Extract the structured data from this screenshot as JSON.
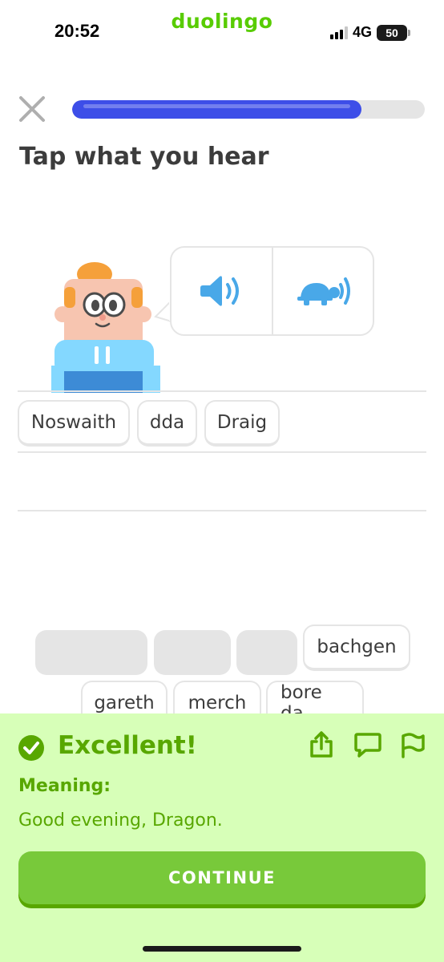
{
  "status_bar": {
    "time": "20:52",
    "app_name": "duolingo",
    "network": "4G",
    "battery": "50"
  },
  "lesson": {
    "progress": 0.82,
    "prompt": "Tap what you hear",
    "audio_buttons": [
      {
        "icon": "speaker-icon"
      },
      {
        "icon": "turtle-slow-audio-icon"
      }
    ]
  },
  "answer": {
    "selected_words": [
      "Noswaith",
      "dda",
      "Draig"
    ]
  },
  "word_bank": {
    "row1": [
      "bachgen"
    ],
    "row2": [
      "gareth",
      "merch",
      "bore da"
    ]
  },
  "feedback": {
    "status": "Excellent!",
    "meaning_label": "Meaning:",
    "meaning_text": "Good evening, Dragon.",
    "continue_label": "CONTINUE"
  },
  "colors": {
    "brand_green": "#58cc02",
    "progress_blue": "#3d4ee8",
    "feedback_bg": "#d7ffb8",
    "feedback_text": "#58a700",
    "button_green": "#78c93a",
    "audio_blue": "#49a8e8"
  }
}
